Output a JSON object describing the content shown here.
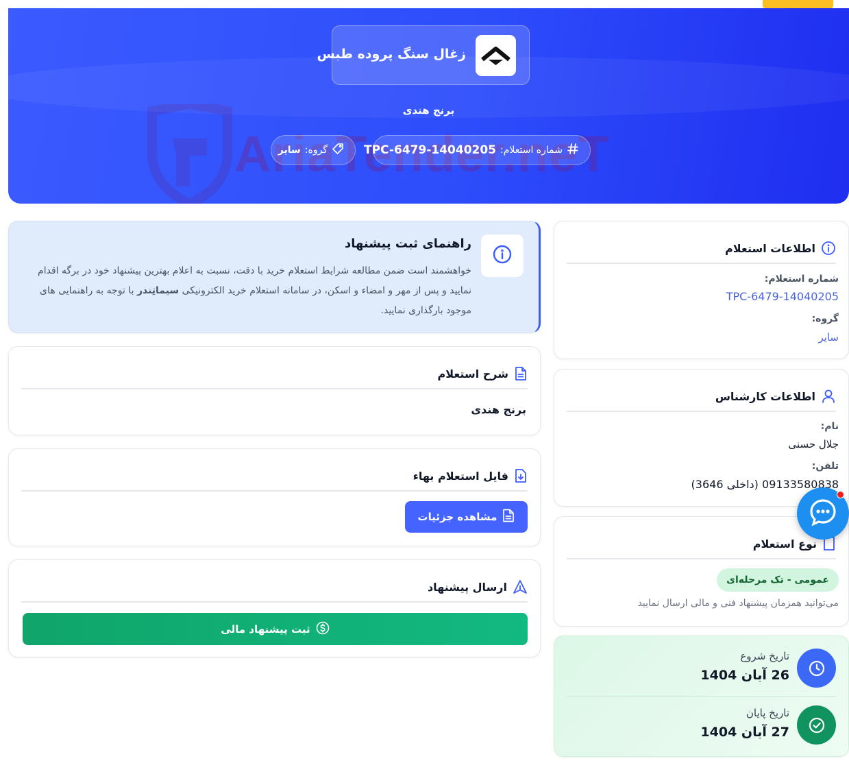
{
  "hero": {
    "brand_name": "زغال سنگ پروده طبس",
    "subtitle": "برنج هندی",
    "inquiry_number_label": "شماره استعلام:",
    "inquiry_number": "TPC-6479-14040205",
    "group_label": "گروه:",
    "group_value": "سایر",
    "watermark_text": "AriaTender.neT"
  },
  "guide": {
    "title": "راهنمای ثبت پیشنهاد",
    "text_1": "خواهشمند است ضمن مطالعه شرایط استعلام خرید با دقت، نسبت به اعلام بهترین پیشنهاد خود در برگه اقدام نمایید و پس از مهر و امضاء و اسکن، در سامانه استعلام خرید الکترونیکی",
    "text_brand": "سیماتِندر",
    "text_2": "با توجه به راهنمایی های موجود بارگذاری نمایید."
  },
  "description": {
    "title": "شرح استعلام",
    "body": "برنج هندی"
  },
  "file": {
    "title": "فایل استعلام بهاء",
    "button_label": "مشاهده جزئیات"
  },
  "send": {
    "title": "ارسال پیشنهاد",
    "button_label": "ثبت پیشنهاد مالی"
  },
  "info": {
    "title": "اطلاعات استعلام",
    "number_label": "شماره استعلام:",
    "number_value": "TPC-6479-14040205",
    "group_label": "گروه:",
    "group_value": "سایر"
  },
  "expert": {
    "title": "اطلاعات کارشناس",
    "name_label": "نام:",
    "name_value": "جلال حسنی",
    "phone_label": "تلفن:",
    "phone_value": "09133580838 (داخلی 3646)"
  },
  "type": {
    "title": "نوع استعلام",
    "badge": "عمومی - تک مرحله‌ای",
    "note": "می‌توانید همزمان پیشنهاد فنی و مالی ارسال نمایید"
  },
  "dates": {
    "start_label": "تاریخ شروع",
    "start_value": "26 آبان 1404",
    "end_label": "تاریخ پایان",
    "end_value": "27 آبان 1404"
  },
  "colors": {
    "primary": "#3b5bff",
    "success": "#10a56a",
    "accent": "#fbbf24"
  },
  "icons": [
    "hash-icon",
    "tag-icon",
    "info-icon",
    "document-icon",
    "file-download-icon",
    "send-icon",
    "dollar-icon",
    "user-icon",
    "clock-icon",
    "check-circle-icon",
    "chat-icon"
  ]
}
